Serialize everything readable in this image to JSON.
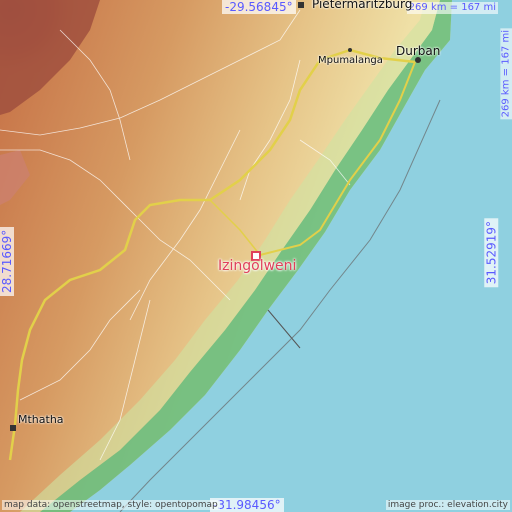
{
  "map": {
    "coords": {
      "top": "-29.56845°",
      "bottom": "-31.98456°",
      "left": "28.71669°",
      "right": "31.52919°"
    },
    "scale": {
      "horizontal": "269 km = 167 mi",
      "vertical": "269 km = 167 mi"
    },
    "credits": {
      "left": "map data: openstreetmap, style: opentopomap",
      "right": "image proc.: elevation.city"
    },
    "places": {
      "pietermaritzburg": "Pietermaritzburg",
      "durban": "Durban",
      "mpumalanga": "Mpumalanga",
      "mthatha": "Mthatha",
      "target": "Izingolweni"
    },
    "colors": {
      "ocean": "#8fd0e0",
      "coast_green": "#5fb87a",
      "lowland": "#e8d49a",
      "highland": "#c87a48",
      "mountain": "#a84c3c",
      "target_marker": "#e0405a",
      "coord_text": "#5a5aff"
    }
  }
}
